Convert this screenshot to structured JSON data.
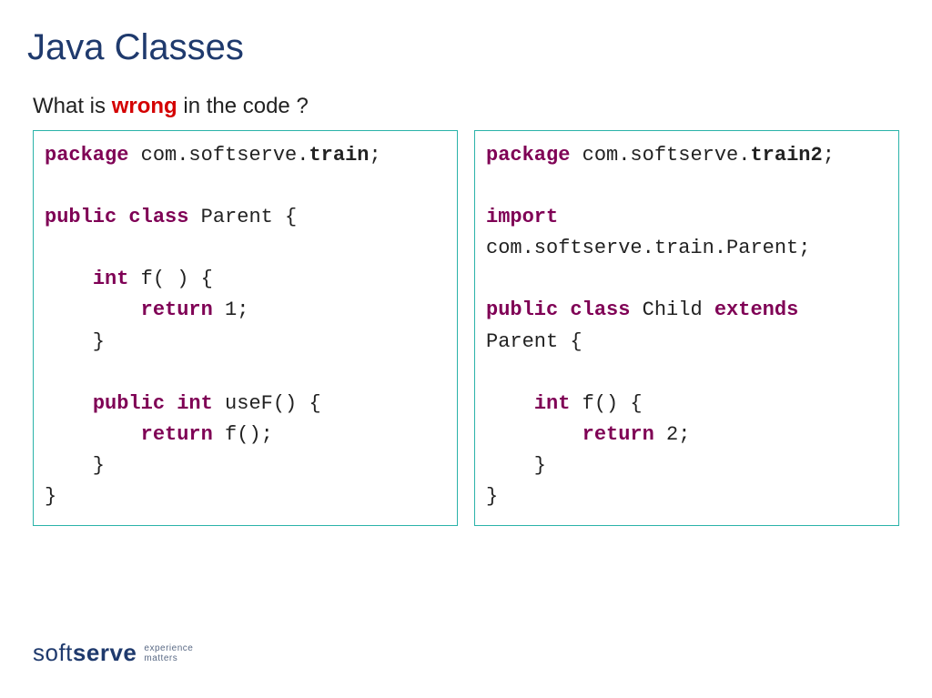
{
  "title": "Java Classes",
  "question_prefix": "What is ",
  "question_wrong": "wrong",
  "question_suffix": " in the code ?",
  "code_left": {
    "kw_package": "package",
    "pkg_prefix": " com.softserve.",
    "pkg_name": "train",
    "semicolon": ";",
    "blank": "",
    "decl_public_class": "public class",
    "decl_parent": " Parent {",
    "indent1": "    ",
    "kw_int": "int",
    "f_sig": " f( ) {",
    "indent2": "        ",
    "kw_return": "return",
    "ret1": " 1;",
    "close_brace_i": "    }",
    "kw_public_int": "public int",
    "usef_sig": " useF() {",
    "ret_f": " f();",
    "close_brace": "}"
  },
  "code_right": {
    "kw_package": "package",
    "pkg_prefix": " com.softserve.",
    "pkg_name": "train2",
    "semicolon": ";",
    "blank": "",
    "kw_import": "import",
    "import_line": "com.softserve.train.Parent;",
    "decl_public_class": "public class",
    "decl_child": " Child ",
    "kw_extends": "extends",
    "decl_parent_line": "Parent {",
    "indent1": "    ",
    "kw_int": "int",
    "f_sig": " f() {",
    "indent2": "        ",
    "kw_return": "return",
    "ret2": " 2;",
    "close_brace_i": "    }",
    "close_brace": "}"
  },
  "logo": {
    "soft": "soft",
    "serve": "serve",
    "tag1": "experience",
    "tag2": "matters"
  }
}
